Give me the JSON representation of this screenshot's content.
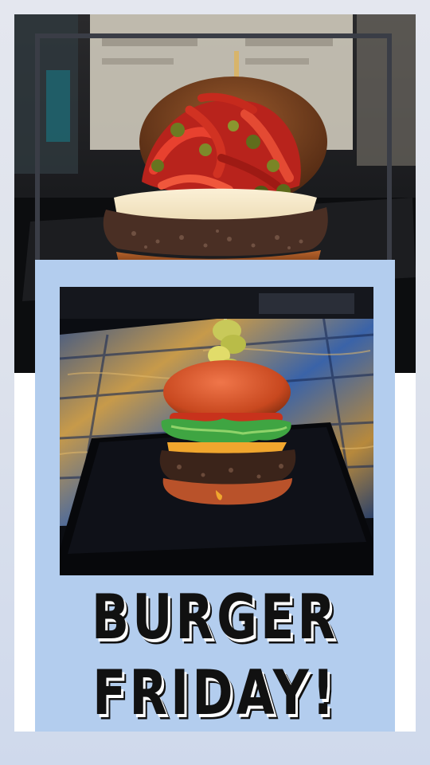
{
  "headline": {
    "line1": "BURGER",
    "line2": "FRIDAY!"
  },
  "images": {
    "top_photo": "burger-with-roasted-peppers-and-jalapenos-photo",
    "inner_photo": "burger-with-lettuce-and-pickles-photo"
  },
  "colors": {
    "page_background": "#dfe3ec",
    "card_blue": "#b3cdee",
    "frame_outline": "#3a3d46",
    "headline_text": "#111111"
  }
}
